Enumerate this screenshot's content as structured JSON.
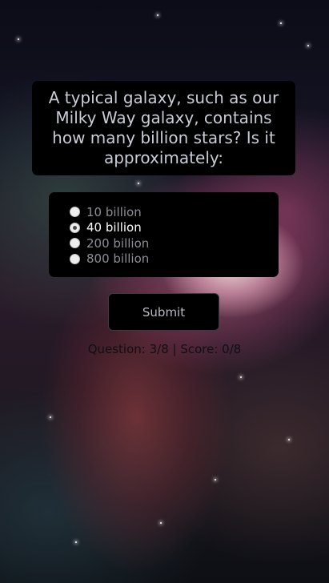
{
  "quiz": {
    "question": "A typical galaxy, such as our Milky Way galaxy, contains how many billion stars? Is it approximately:",
    "options": [
      {
        "label": "10 billion",
        "selected": false
      },
      {
        "label": "40 billion",
        "selected": true
      },
      {
        "label": "200 billion",
        "selected": false
      },
      {
        "label": "800 billion",
        "selected": false
      }
    ],
    "submit_label": "Submit",
    "status": "Question: 3/8 | Score: 0/8"
  },
  "theme": {
    "panel_color": "#000000",
    "question_text_color": "#c9ccd6",
    "option_text_color": "#8e8e96",
    "selected_option_color": "#ffffff"
  }
}
